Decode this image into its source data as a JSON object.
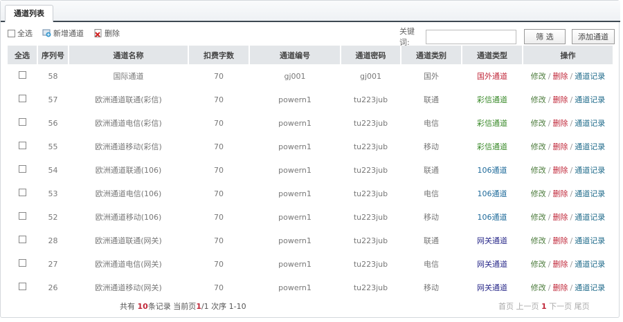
{
  "tab": "通道列表",
  "toolbar": {
    "select_all": "全选",
    "add": "新增通道",
    "delete": "删除"
  },
  "search": {
    "label": "关键词:",
    "value": "",
    "filter_btn": "筛 选",
    "add_btn": "添加通道"
  },
  "columns": [
    "全选",
    "序列号",
    "通道名称",
    "扣费字数",
    "通道编号",
    "通道密码",
    "通道类别",
    "通道类型",
    "操作"
  ],
  "actions": {
    "edit": "修改",
    "delete": "删除",
    "record": "通道记录"
  },
  "type_colors": {
    "国外通道": "#c0283a",
    "彩信通道": "#3a8a2a",
    "106通道": "#1e6a9a",
    "网关通道": "#2a2a8a"
  },
  "rows": [
    {
      "id": "58",
      "name": "国际通道",
      "chars": "70",
      "code": "gj001",
      "pwd": "gj001",
      "cat": "国外",
      "type": "国外通道"
    },
    {
      "id": "57",
      "name": "欧洲通道联通(彩信)",
      "chars": "70",
      "code": "powern1",
      "pwd": "tu223jub",
      "cat": "联通",
      "type": "彩信通道"
    },
    {
      "id": "56",
      "name": "欧洲通道电信(彩信)",
      "chars": "70",
      "code": "powern1",
      "pwd": "tu223jub",
      "cat": "电信",
      "type": "彩信通道"
    },
    {
      "id": "55",
      "name": "欧洲通道移动(彩信)",
      "chars": "70",
      "code": "powern1",
      "pwd": "tu223jub",
      "cat": "移动",
      "type": "彩信通道"
    },
    {
      "id": "54",
      "name": "欧洲通道联通(106)",
      "chars": "70",
      "code": "powern1",
      "pwd": "tu223jub",
      "cat": "联通",
      "type": "106通道"
    },
    {
      "id": "53",
      "name": "欧洲通道电信(106)",
      "chars": "70",
      "code": "powern1",
      "pwd": "tu223jub",
      "cat": "电信",
      "type": "106通道"
    },
    {
      "id": "52",
      "name": "欧洲通道移动(106)",
      "chars": "70",
      "code": "powern1",
      "pwd": "tu223jub",
      "cat": "移动",
      "type": "106通道"
    },
    {
      "id": "28",
      "name": "欧洲通道联通(网关)",
      "chars": "70",
      "code": "powern1",
      "pwd": "tu223jub",
      "cat": "联通",
      "type": "网关通道"
    },
    {
      "id": "27",
      "name": "欧洲通道电信(网关)",
      "chars": "70",
      "code": "powern1",
      "pwd": "tu223jub",
      "cat": "电信",
      "type": "网关通道"
    },
    {
      "id": "26",
      "name": "欧洲通道移动(网关)",
      "chars": "70",
      "code": "powern1",
      "pwd": "tu223jub",
      "cat": "移动",
      "type": "网关通道"
    }
  ],
  "footer": {
    "t1": "共有 ",
    "total": "10",
    "t2": "条记录 当前页",
    "page": "1",
    "t3": "/1 次序 1-10"
  },
  "pager": {
    "first": "首页",
    "prev": "上一页",
    "current": "1",
    "next": "下一页",
    "last": "尾页"
  }
}
